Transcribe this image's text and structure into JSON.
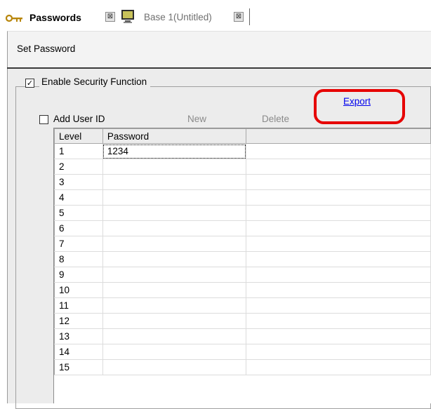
{
  "tabs": [
    {
      "label": "Passwords",
      "icon": "key-icon",
      "close": "⊠"
    },
    {
      "label": "Base 1(Untitled)",
      "icon": "screen-icon",
      "close": "⊠"
    }
  ],
  "toolbar": {
    "set_password_label": "Set Password"
  },
  "security": {
    "enable_label": "Enable Security Function",
    "enable_checked": true,
    "enable_mark": "✓",
    "export_label": "Export",
    "highlight_color": "#e60000"
  },
  "user_id": {
    "add_label": "Add User ID",
    "add_checked": false,
    "new_label": "New",
    "delete_label": "Delete"
  },
  "grid": {
    "columns": [
      "Level",
      "Password"
    ],
    "rows": [
      {
        "level": "1",
        "password": "1234"
      },
      {
        "level": "2",
        "password": ""
      },
      {
        "level": "3",
        "password": ""
      },
      {
        "level": "4",
        "password": ""
      },
      {
        "level": "5",
        "password": ""
      },
      {
        "level": "6",
        "password": ""
      },
      {
        "level": "7",
        "password": ""
      },
      {
        "level": "8",
        "password": ""
      },
      {
        "level": "9",
        "password": ""
      },
      {
        "level": "10",
        "password": ""
      },
      {
        "level": "11",
        "password": ""
      },
      {
        "level": "12",
        "password": ""
      },
      {
        "level": "13",
        "password": ""
      },
      {
        "level": "14",
        "password": ""
      },
      {
        "level": "15",
        "password": ""
      }
    ]
  }
}
